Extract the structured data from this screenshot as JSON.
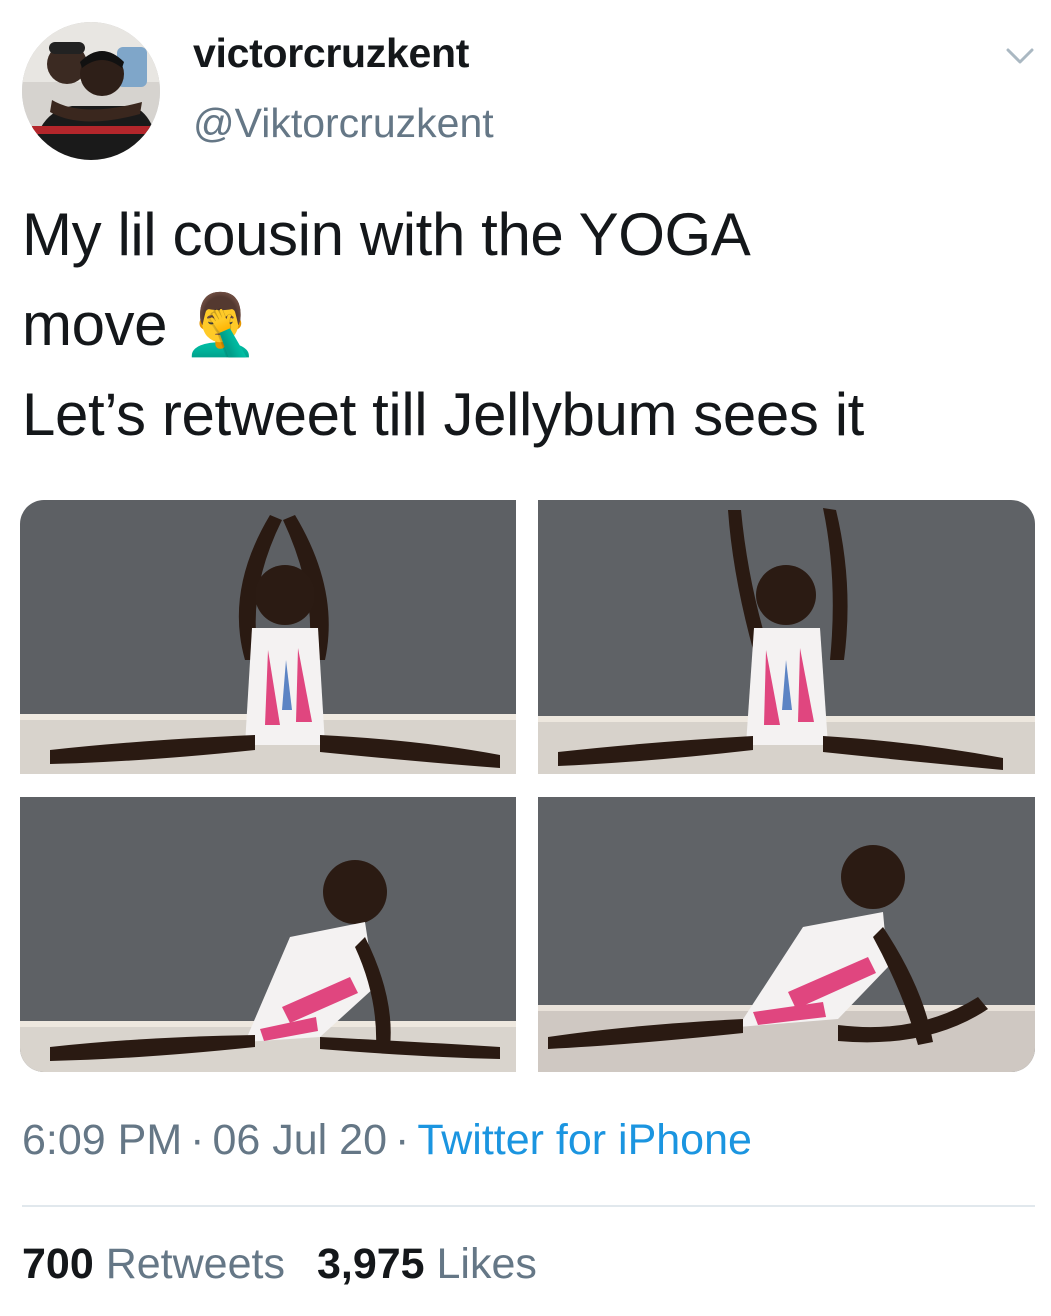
{
  "user": {
    "display_name": "victorcruzkent",
    "handle": "@Viktorcruzkent",
    "avatar_icon": "profile-photo"
  },
  "tweet": {
    "lines": [
      "My lil cousin with the YOGA",
      "move 🤦‍♂",
      "Let’s retweet till Jellybum sees it"
    ]
  },
  "media": {
    "photos": [
      {
        "description_icon": "photo-child-split-arms-up"
      },
      {
        "description_icon": "photo-child-split-arms-up"
      },
      {
        "description_icon": "photo-child-split-leaning"
      },
      {
        "description_icon": "photo-child-split-leaning"
      }
    ]
  },
  "meta": {
    "time": "6:09 PM",
    "separator": "·",
    "date": "06 Jul 20",
    "source": "Twitter for iPhone"
  },
  "stats": {
    "retweets_count": "700",
    "retweets_label": "Retweets",
    "likes_count": "3,975",
    "likes_label": "Likes"
  },
  "colors": {
    "text_primary": "#14171a",
    "text_secondary": "#657786",
    "link": "#1b95e0",
    "divider": "#e1e8ed"
  }
}
